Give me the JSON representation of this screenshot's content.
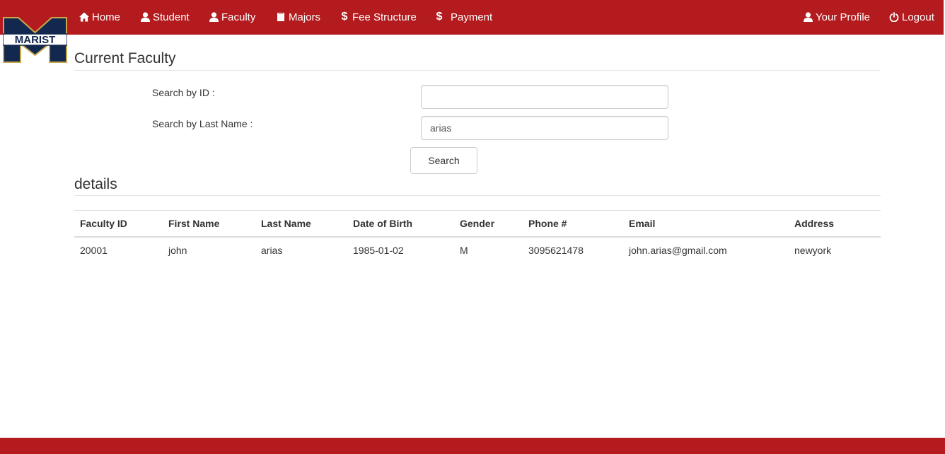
{
  "brand": {
    "logo_text": "MARIST",
    "colors": {
      "navy": "#13284e",
      "gold": "#c8a84b",
      "nav_red": "#b31b1e"
    }
  },
  "nav": {
    "items": [
      {
        "label": "Home",
        "icon": "home-icon"
      },
      {
        "label": "Student",
        "icon": "user-icon"
      },
      {
        "label": "Faculty",
        "icon": "user-icon"
      },
      {
        "label": "Majors",
        "icon": "book-icon"
      },
      {
        "label": "Fee Structure",
        "icon": "dollar-icon"
      },
      {
        "label": "Payment",
        "icon": "dollar-icon"
      }
    ],
    "right": [
      {
        "label": "Your Profile",
        "icon": "user-icon"
      },
      {
        "label": "Logout",
        "icon": "power-icon"
      }
    ]
  },
  "page": {
    "title": "Current Faculty"
  },
  "search": {
    "id_label": "Search by ID :",
    "id_value": "",
    "lastname_label": "Search by Last Name :",
    "lastname_value": "arias",
    "button_label": "Search"
  },
  "details": {
    "title": "details",
    "columns": [
      "Faculty ID",
      "First Name",
      "Last Name",
      "Date of Birth",
      "Gender",
      "Phone #",
      "Email",
      "Address"
    ],
    "rows": [
      [
        "20001",
        "john",
        "arias",
        "1985-01-02",
        "M",
        "3095621478",
        "john.arias@gmail.com",
        "newyork"
      ]
    ]
  }
}
